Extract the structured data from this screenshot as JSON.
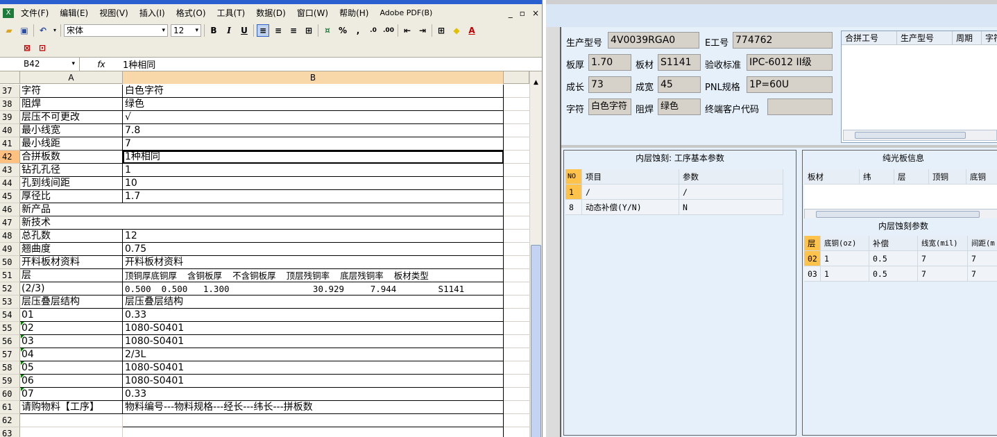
{
  "excel": {
    "menu": [
      "文件(F)",
      "编辑(E)",
      "视图(V)",
      "插入(I)",
      "格式(O)",
      "工具(T)",
      "数据(D)",
      "窗口(W)",
      "帮助(H)",
      "Adobe PDF(B)"
    ],
    "window_controls": [
      "_",
      "▫",
      "×"
    ],
    "font_name": "宋体",
    "font_size": "12",
    "name_box": "B42",
    "fx": "fx",
    "formula": "1种相同",
    "columns": [
      "A",
      "B"
    ],
    "rows": [
      {
        "n": "37",
        "a": "字符",
        "b": "白色字符"
      },
      {
        "n": "38",
        "a": "阻焊",
        "b": "绿色"
      },
      {
        "n": "39",
        "a": "层压不可更改",
        "b": "√"
      },
      {
        "n": "40",
        "a": "最小线宽",
        "b": "7.8"
      },
      {
        "n": "41",
        "a": "最小线距",
        "b": "7"
      },
      {
        "n": "42",
        "a": "合拼板数",
        "b": "1种相同"
      },
      {
        "n": "43",
        "a": "钻孔孔径",
        "b": "1"
      },
      {
        "n": "44",
        "a": "孔到线间距",
        "b": "10"
      },
      {
        "n": "45",
        "a": "厚径比",
        "b": "1.7"
      },
      {
        "n": "46",
        "a": "新产品",
        "b": ""
      },
      {
        "n": "47",
        "a": "新技术",
        "b": ""
      },
      {
        "n": "48",
        "a": "总孔数",
        "b": "12"
      },
      {
        "n": "49",
        "a": "翘曲度",
        "b": "0.75"
      },
      {
        "n": "50",
        "a": "开料板材资料",
        "b": "开料板材资料"
      },
      {
        "n": "51",
        "a": "层",
        "b": "顶铜厚底铜厚  含铜板厚  不含铜板厚  顶层残铜率  底层残铜率  板材类型"
      },
      {
        "n": "52",
        "a": "(2/3)",
        "b": "0.500  0.500   1.300                30.929     7.944        S1141"
      },
      {
        "n": "53",
        "a": "层压叠层结构",
        "b": "层压叠层结构"
      },
      {
        "n": "54",
        "a": "01",
        "b": "0.33"
      },
      {
        "n": "55",
        "a": "02",
        "b": "1080-S0401"
      },
      {
        "n": "56",
        "a": "03",
        "b": "1080-S0401"
      },
      {
        "n": "57",
        "a": "04",
        "b": "2/3L"
      },
      {
        "n": "58",
        "a": "05",
        "b": "1080-S0401"
      },
      {
        "n": "59",
        "a": "06",
        "b": "1080-S0401"
      },
      {
        "n": "60",
        "a": "07",
        "b": "0.33"
      },
      {
        "n": "61",
        "a": "请购物料【工序】",
        "b": "物料编号---物料规格---经长---纬长---拼板数"
      },
      {
        "n": "62",
        "a": "",
        "b": ""
      },
      {
        "n": "63",
        "a": "",
        "b": ""
      }
    ]
  },
  "app": {
    "labels": {
      "model": "生产型号",
      "e_no": "E工号",
      "thickness": "板厚",
      "material": "板材",
      "standard": "验收标准",
      "length": "成长",
      "width": "成宽",
      "pnl": "PNL规格",
      "legend": "字符",
      "solder": "阻焊",
      "customer_code": "终端客户代码"
    },
    "values": {
      "model": "4V0039RGA0",
      "e_no": "774762",
      "thickness": "1.70",
      "material": "S1141",
      "standard": "IPC-6012 II级",
      "length": "73",
      "width": "45",
      "pnl": "1P=60U",
      "legend": "白色字符",
      "solder": "绿色",
      "customer_code": ""
    },
    "merge_grid_headers": [
      "合拼工号",
      "生产型号",
      "周期",
      "字符"
    ],
    "inner_etch_title": "内层蚀刻: 工序基本参数",
    "inner_etch_headers": [
      "NO",
      "项目",
      "参数"
    ],
    "inner_etch_rows": [
      {
        "no": "1",
        "item": "/",
        "param": "/"
      },
      {
        "no": "8",
        "item": "动态补偿(Y/N)",
        "param": "N"
      }
    ],
    "pure_board_title": "纯光板信息",
    "pure_board_headers": [
      "板材",
      "纬",
      "层",
      "顶铜",
      "底铜"
    ],
    "etch_params_title": "内层蚀刻参数",
    "etch_params_headers": [
      "层",
      "底铜(oz)",
      "补偿",
      "线宽(mil)",
      "间距(m"
    ],
    "etch_params_rows": [
      {
        "layer": "02",
        "base": "1",
        "comp": "0.5",
        "line": "7",
        "space": "7"
      },
      {
        "layer": "03",
        "base": "1",
        "comp": "0.5",
        "line": "7",
        "space": "7"
      }
    ]
  }
}
